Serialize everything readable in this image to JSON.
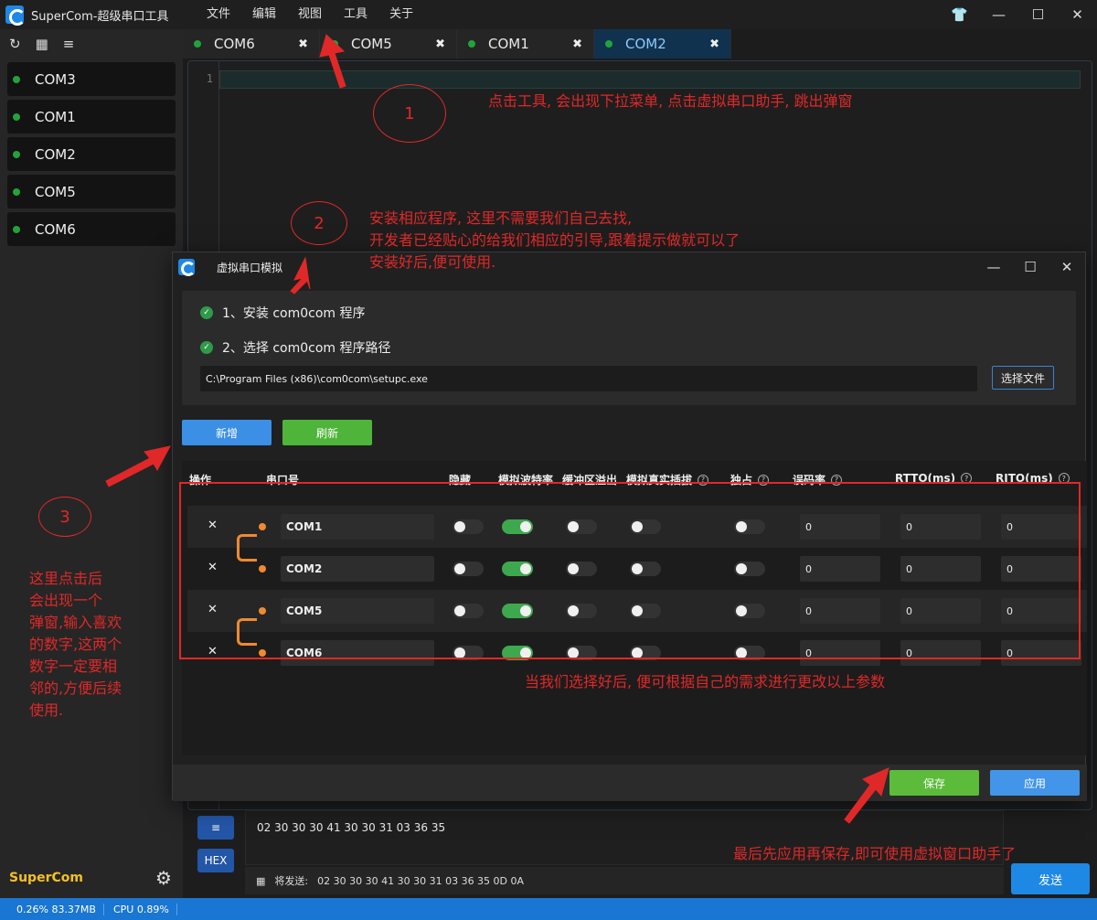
{
  "app": {
    "title": "SuperCom-超级串口工具",
    "brand": "SuperCom"
  },
  "menu": [
    "文件",
    "编辑",
    "视图",
    "工具",
    "关于"
  ],
  "sidebar": {
    "ports": [
      "COM3",
      "COM1",
      "COM2",
      "COM5",
      "COM6"
    ]
  },
  "tabs": [
    {
      "label": "COM6",
      "active": false
    },
    {
      "label": "COM5",
      "active": false
    },
    {
      "label": "COM1",
      "active": false
    },
    {
      "label": "COM2",
      "active": true
    }
  ],
  "editor": {
    "line_number": "1"
  },
  "send": {
    "hex_content": "02 30 30 30 41 30 30 31 03 36 35",
    "pending_label": "将发送:",
    "pending_value": "02 30 30 30 41 30 30 31 03 36 35 0D 0A",
    "send_button": "发送",
    "hex_button": "HEX"
  },
  "status": {
    "mem": "0.26% 83.37MB",
    "cpu": "CPU 0.89%"
  },
  "dialog": {
    "title": "虚拟串口模拟",
    "step1": "1、安装 com0com 程序",
    "step2": "2、选择 com0com 程序路径",
    "path": "C:\\Program Files (x86)\\com0com\\setupc.exe",
    "choose_file": "选择文件",
    "add": "新增",
    "refresh": "刷新",
    "headers": {
      "op": "操作",
      "port": "串口号",
      "hide": "隐藏",
      "baud": "模拟波特率",
      "overflow": "缓冲区溢出",
      "plug": "模拟真实插拔",
      "exclusive": "独占",
      "error_rate": "误码率",
      "rtto": "RTTO(ms)",
      "rito": "RITO(ms)"
    },
    "rows": [
      {
        "port": "COM1",
        "hide": false,
        "baud": true,
        "overflow": false,
        "plug": false,
        "exclusive": false,
        "error_rate": "0",
        "rtto": "0",
        "rito": "0"
      },
      {
        "port": "COM2",
        "hide": false,
        "baud": true,
        "overflow": false,
        "plug": false,
        "exclusive": false,
        "error_rate": "0",
        "rtto": "0",
        "rito": "0"
      },
      {
        "port": "COM5",
        "hide": false,
        "baud": true,
        "overflow": false,
        "plug": false,
        "exclusive": false,
        "error_rate": "0",
        "rtto": "0",
        "rito": "0"
      },
      {
        "port": "COM6",
        "hide": false,
        "baud": true,
        "overflow": false,
        "plug": false,
        "exclusive": false,
        "error_rate": "0",
        "rtto": "0",
        "rito": "0"
      }
    ],
    "save": "保存",
    "apply": "应用"
  },
  "annotations": {
    "circle1": "1",
    "note1": "点击工具, 会出现下拉菜单, 点击虚拟串口助手, 跳出弹窗",
    "circle2": "2",
    "note2_line1": "安装相应程序, 这里不需要我们自己去找,",
    "note2_line2": "开发者已经贴心的给我们相应的引导,跟着提示做就可以了",
    "note2_line3": "安装好后,便可使用.",
    "circle3": "3",
    "note3_lines": [
      "这里点击后",
      "会出现一个",
      "弹窗,输入喜欢",
      "的数字,这两个",
      "数字一定要相",
      "邻的,方便后续",
      "使用."
    ],
    "note4": "当我们选择好后, 便可根据自己的需求进行更改以上参数",
    "note5": "最后先应用再保存,即可使用虚拟窗口助手了",
    "color": "#e02828"
  },
  "colors": {
    "accent": "#1e88e5",
    "connected": "#22a33a",
    "bracket": "#f08a30"
  }
}
